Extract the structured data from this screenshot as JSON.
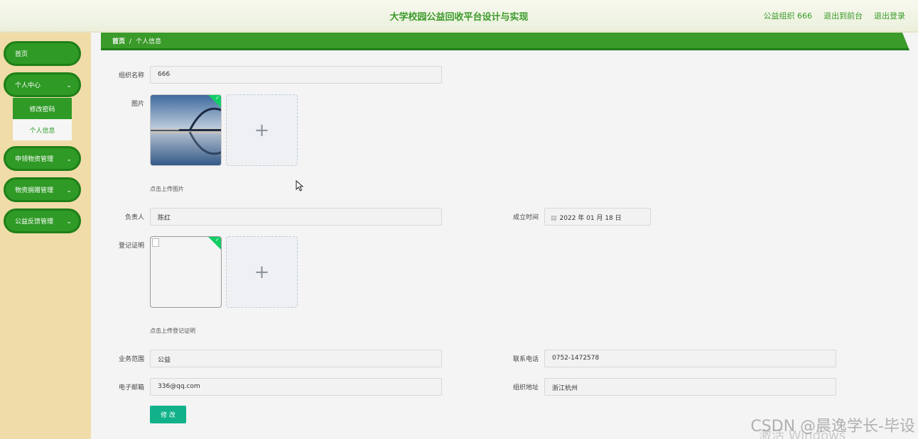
{
  "header": {
    "title": "大学校园公益回收平台设计与实现",
    "user_label": "公益组织 666",
    "to_front_label": "退出到前台",
    "logout_label": "退出登录"
  },
  "sidebar": {
    "items": [
      {
        "label": "首页"
      },
      {
        "label": "个人中心",
        "expanded": true
      },
      {
        "label": "申领物资管理"
      },
      {
        "label": "物资捐赠管理"
      },
      {
        "label": "公益反馈管理"
      }
    ],
    "sub_items": [
      {
        "label": "修改密码",
        "active": true
      },
      {
        "label": "个人信息"
      }
    ]
  },
  "breadcrumb": {
    "home": "首页",
    "separator": "/",
    "current": "个人信息"
  },
  "form": {
    "org_name_label": "组织名称",
    "org_name_value": "666",
    "image_label": "图片",
    "image_hint": "点击上传图片",
    "leader_label": "负责人",
    "leader_value": "陈红",
    "founded_label": "成立时间",
    "founded_value": "2022 年 01 月 18 日",
    "cert_label": "登记证明",
    "cert_hint": "点击上传登记证明",
    "scope_label": "业务范围",
    "scope_value": "公益",
    "phone_label": "联系电话",
    "phone_value": "0752-1472578",
    "email_label": "电子邮箱",
    "email_value": "336@qq.com",
    "address_label": "组织地址",
    "address_value": "浙江杭州",
    "submit_label": "修 改",
    "add_symbol": "+"
  },
  "overlay": {
    "watermark": "CSDN @晨逸学长-毕设",
    "activate": "激活 Windows"
  },
  "colors": {
    "brand_green": "#3a9a2a",
    "sidebar_bg": "#f0dca8",
    "submit_teal": "#11b28a",
    "upload_ok": "#13ce66"
  }
}
